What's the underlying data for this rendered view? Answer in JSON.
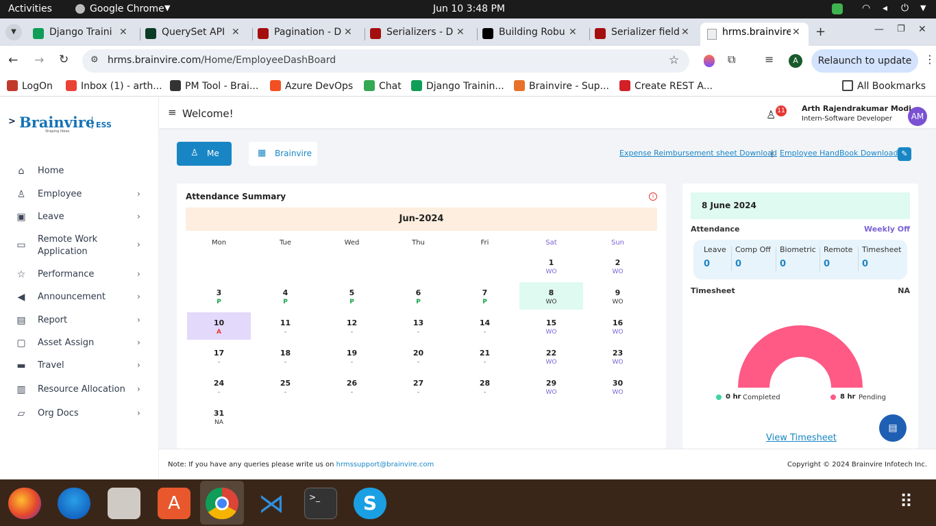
{
  "system": {
    "activities": "Activities",
    "app": "Google Chrome",
    "clock": "Jun 10  3:48 PM"
  },
  "tabs": [
    {
      "title": "Django Traini",
      "color": "#0f9d58"
    },
    {
      "title": "QuerySet API",
      "color": "#0c3c26"
    },
    {
      "title": "Pagination - D",
      "color": "#a50e0e"
    },
    {
      "title": "Serializers - D",
      "color": "#a50e0e"
    },
    {
      "title": "Building Robu",
      "color": "#000000"
    },
    {
      "title": "Serializer field",
      "color": "#a50e0e"
    },
    {
      "title": "hrms.brainvire",
      "color": "#9aa0a6"
    }
  ],
  "browser": {
    "url_host": "hrms.brainvire.com",
    "url_path": "/Home/EmployeeDashBoard",
    "relaunch": "Relaunch to update",
    "profile_initial": "A"
  },
  "bookmarks": [
    {
      "label": "LogOn",
      "color": "#c0392b"
    },
    {
      "label": "Inbox (1) - arth...",
      "color": "#ea4335"
    },
    {
      "label": "PM Tool - Brai...",
      "color": "#333333"
    },
    {
      "label": "Azure DevOps",
      "color": "#f25022"
    },
    {
      "label": "Chat",
      "color": "#34a853"
    },
    {
      "label": "Django Trainin...",
      "color": "#0f9d58"
    },
    {
      "label": "Brainvire - Sup...",
      "color": "#e8712a"
    },
    {
      "label": "Create REST A...",
      "color": "#d31f26"
    }
  ],
  "all_bookmarks": "All Bookmarks",
  "brand": {
    "name": "Brainvire",
    "suffix": "ESS",
    "tagline": "Shaping Ideas"
  },
  "nav": [
    {
      "label": "Home",
      "icon": "home-icon",
      "glyph": "⌂",
      "chev": false
    },
    {
      "label": "Employee",
      "icon": "user-icon",
      "glyph": "♙",
      "chev": true
    },
    {
      "label": "Leave",
      "icon": "calendar-check-icon",
      "glyph": "▣",
      "chev": true
    },
    {
      "label": "Remote Work\nApplication",
      "icon": "monitor-icon",
      "glyph": "▭",
      "chev": true
    },
    {
      "label": "Performance",
      "icon": "star-icon",
      "glyph": "☆",
      "chev": true
    },
    {
      "label": "Announcement",
      "icon": "megaphone-icon",
      "glyph": "◀",
      "chev": true
    },
    {
      "label": "Report",
      "icon": "report-icon",
      "glyph": "▤",
      "chev": true
    },
    {
      "label": "Asset Assign",
      "icon": "briefcase-icon",
      "glyph": "▢",
      "chev": true
    },
    {
      "label": "Travel",
      "icon": "car-icon",
      "glyph": "▬",
      "chev": true
    },
    {
      "label": "Resource Allocation",
      "icon": "bar-chart-icon",
      "glyph": "▥",
      "chev": true
    },
    {
      "label": "Org Docs",
      "icon": "folder-icon",
      "glyph": "▱",
      "chev": true
    }
  ],
  "header": {
    "welcome": "Welcome!",
    "notif_count": "11",
    "user_name": "Arth Rajendrakumar Modi",
    "user_role": "Intern-Software Developer",
    "avatar": "AM"
  },
  "switch": {
    "me": "Me",
    "company": "Brainvire"
  },
  "links": {
    "expense": "Expense Reimbursement sheet Download",
    "sep": "|",
    "handbook": "Employee HandBook Download"
  },
  "attendance_summary": {
    "title": "Attendance Summary",
    "month": "Jun-2024",
    "weekdays": [
      "Mon",
      "Tue",
      "Wed",
      "Thu",
      "Fri",
      "Sat",
      "Sun"
    ],
    "weeks": [
      [
        null,
        null,
        null,
        null,
        null,
        {
          "d": "1",
          "s": "WO"
        },
        {
          "d": "2",
          "s": "WO"
        }
      ],
      [
        {
          "d": "3",
          "s": "P"
        },
        {
          "d": "4",
          "s": "P"
        },
        {
          "d": "5",
          "s": "P"
        },
        {
          "d": "6",
          "s": "P"
        },
        {
          "d": "7",
          "s": "P"
        },
        {
          "d": "8",
          "s": "WO",
          "sel": true
        },
        {
          "d": "9",
          "s": "WO"
        }
      ],
      [
        {
          "d": "10",
          "s": "A",
          "today": true
        },
        {
          "d": "11",
          "s": "-"
        },
        {
          "d": "12",
          "s": "-"
        },
        {
          "d": "13",
          "s": "-"
        },
        {
          "d": "14",
          "s": "-"
        },
        {
          "d": "15",
          "s": "WO"
        },
        {
          "d": "16",
          "s": "WO"
        }
      ],
      [
        {
          "d": "17",
          "s": "-"
        },
        {
          "d": "18",
          "s": "-"
        },
        {
          "d": "19",
          "s": "-"
        },
        {
          "d": "20",
          "s": "-"
        },
        {
          "d": "21",
          "s": "-"
        },
        {
          "d": "22",
          "s": "WO"
        },
        {
          "d": "23",
          "s": "WO"
        }
      ],
      [
        {
          "d": "24",
          "s": "-"
        },
        {
          "d": "25",
          "s": "-"
        },
        {
          "d": "26",
          "s": "-"
        },
        {
          "d": "27",
          "s": "-"
        },
        {
          "d": "28",
          "s": "-"
        },
        {
          "d": "29",
          "s": "WO"
        },
        {
          "d": "30",
          "s": "WO"
        }
      ],
      [
        {
          "d": "31",
          "s": "NA"
        },
        null,
        null,
        null,
        null,
        null,
        null
      ]
    ]
  },
  "day_detail": {
    "date": "8 June 2024",
    "attendance_label": "Attendance",
    "attendance_value": "Weekly Off",
    "stats": [
      {
        "label": "Leave",
        "value": "0"
      },
      {
        "label": "Comp Off",
        "value": "0"
      },
      {
        "label": "Biometric",
        "value": "0"
      },
      {
        "label": "Remote",
        "value": "0"
      },
      {
        "label": "Timesheet",
        "value": "0"
      }
    ],
    "timesheet_label": "Timesheet",
    "timesheet_value": "NA",
    "completed_value": "0 hr",
    "completed_label": "Completed",
    "pending_value": "8 hr",
    "pending_label": "Pending",
    "completed_fraction": 0,
    "view_timesheet": "View Timesheet"
  },
  "footer": {
    "note": "Note: If you have any queries please write us on",
    "email": "hrmssupport@brainvire.com",
    "copyright": "Copyright © 2024 Brainvire Infotech Inc."
  },
  "colors": {
    "accent": "#1886c4",
    "pending": "#fe5a85",
    "completed": "#3dd6a3",
    "weekend": "#7b62d5",
    "present": "#1aa04a",
    "absent": "#e53935"
  }
}
